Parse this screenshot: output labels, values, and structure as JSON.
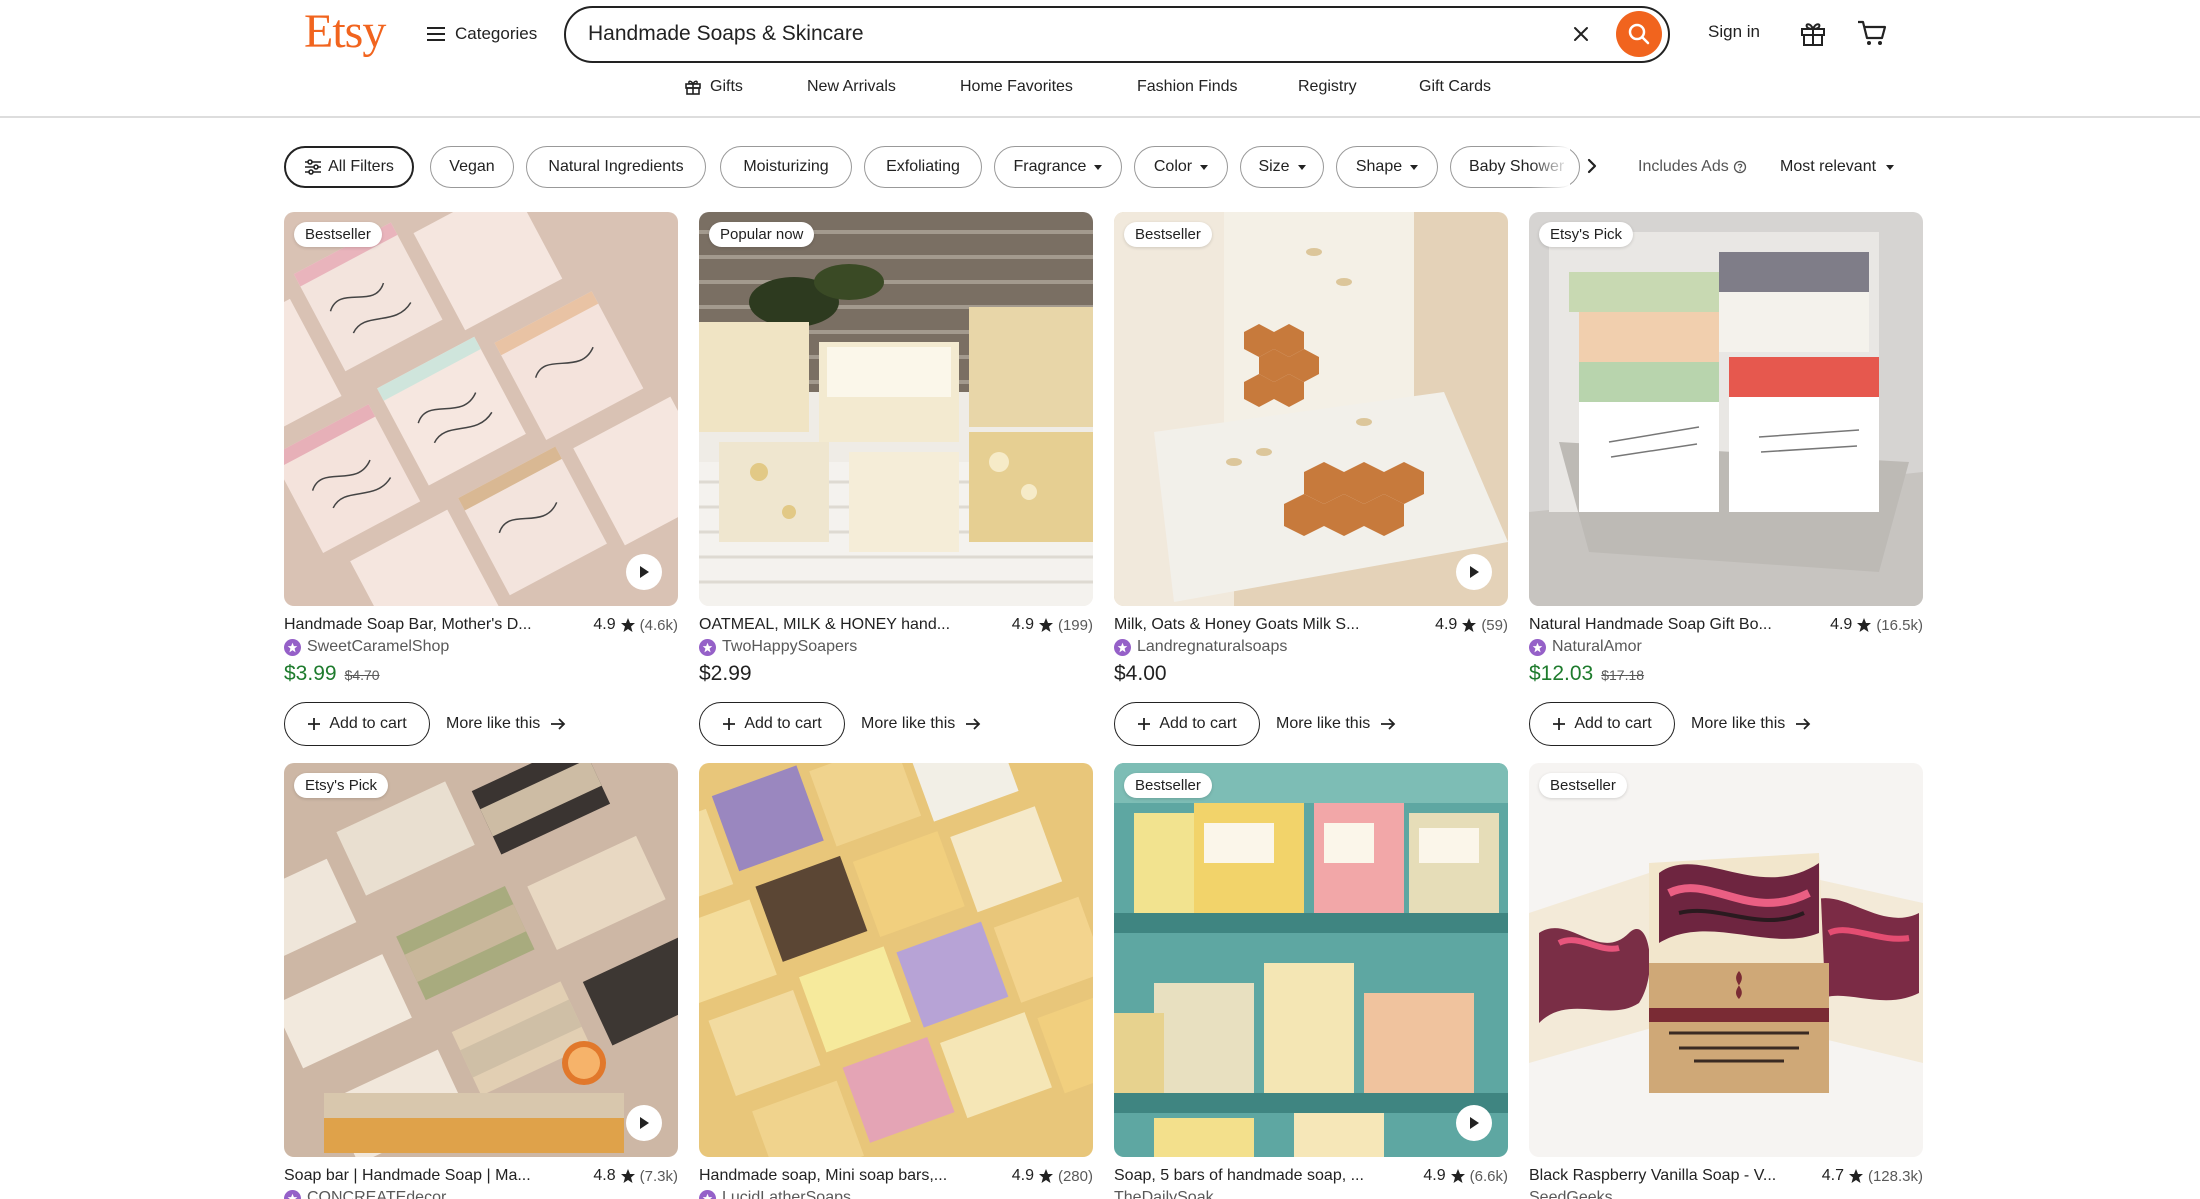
{
  "header": {
    "logo": "Etsy",
    "categories_label": "Categories",
    "search_value": "Handmade Soaps & Skincare",
    "sign_in": "Sign in"
  },
  "subnav": [
    {
      "label": "Gifts",
      "icon": "gift-icon"
    },
    {
      "label": "New Arrivals"
    },
    {
      "label": "Home Favorites"
    },
    {
      "label": "Fashion Finds"
    },
    {
      "label": "Registry"
    },
    {
      "label": "Gift Cards"
    }
  ],
  "filters": {
    "chips": [
      "All Filters",
      "Vegan",
      "Natural Ingredients",
      "Moisturizing",
      "Exfoliating",
      "Fragrance",
      "Color",
      "Size",
      "Shape",
      "Baby Shower"
    ],
    "includes_ads": "Includes Ads",
    "sort": "Most relevant"
  },
  "colors": {
    "brand": "#f1641e",
    "sale_price": "#1e7b2d",
    "star_seller": "#9560c8"
  },
  "products": [
    {
      "badge": "Bestseller",
      "title": "Handmade Soap Bar, Mother's D...",
      "rating": "4.9",
      "reviews": "(4.6k)",
      "shop": "SweetCaramelShop",
      "price": "$3.99",
      "original_price": "$4.70",
      "add_to_cart": "Add to cart",
      "more_like_this": "More like this"
    },
    {
      "badge": "Popular now",
      "title": "OATMEAL, MILK & HONEY hand...",
      "rating": "4.9",
      "reviews": "(199)",
      "shop": "TwoHappySoapers",
      "price": "$2.99",
      "original_price": "",
      "add_to_cart": "Add to cart",
      "more_like_this": "More like this"
    },
    {
      "badge": "Bestseller",
      "title": "Milk, Oats & Honey Goats Milk S...",
      "rating": "4.9",
      "reviews": "(59)",
      "shop": "Landregnaturalsoaps",
      "price": "$4.00",
      "original_price": "",
      "add_to_cart": "Add to cart",
      "more_like_this": "More like this"
    },
    {
      "badge": "Etsy's Pick",
      "title": "Natural Handmade Soap Gift Bo...",
      "rating": "4.9",
      "reviews": "(16.5k)",
      "shop": "NaturalAmor",
      "price": "$12.03",
      "original_price": "$17.18",
      "add_to_cart": "Add to cart",
      "more_like_this": "More like this"
    },
    {
      "badge": "Etsy's Pick",
      "title": "Soap bar | Handmade Soap | Ma...",
      "rating": "4.8",
      "reviews": "(7.3k)",
      "shop": "CONCREATEdecor"
    },
    {
      "badge": "",
      "title": "Handmade soap, Mini soap bars,...",
      "rating": "4.9",
      "reviews": "(280)",
      "shop": "LucidLatherSoaps"
    },
    {
      "badge": "Bestseller",
      "title": "Soap, 5 bars of handmade soap, ...",
      "rating": "4.9",
      "reviews": "(6.6k)",
      "shop": "TheDailySoak"
    },
    {
      "badge": "Bestseller",
      "title": "Black Raspberry Vanilla Soap - V...",
      "rating": "4.7",
      "reviews": "(128.3k)",
      "shop": "SeedGeeks"
    }
  ]
}
